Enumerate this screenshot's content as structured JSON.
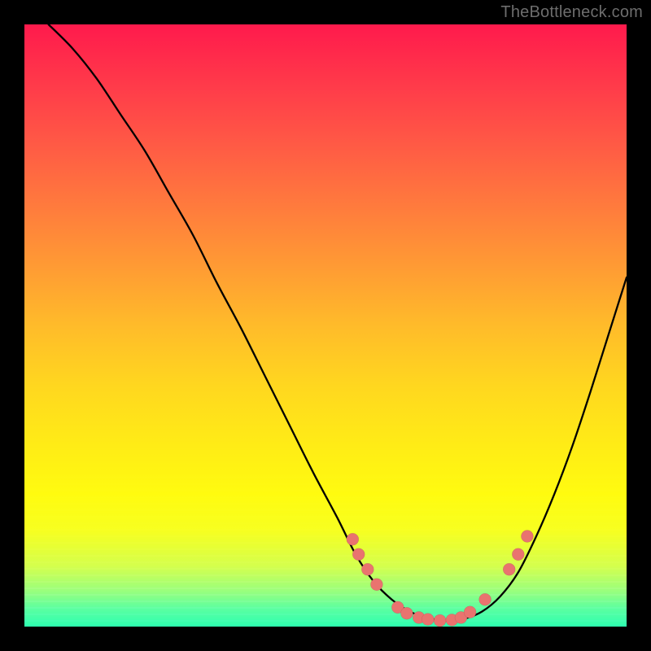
{
  "watermark": "TheBottleneck.com",
  "chart_data": {
    "type": "line",
    "title": "",
    "xlabel": "",
    "ylabel": "",
    "xlim": [
      0,
      100
    ],
    "ylim": [
      0,
      100
    ],
    "grid": false,
    "series": [
      {
        "name": "curve",
        "x": [
          4,
          8,
          12,
          16,
          20,
          24,
          28,
          32,
          36,
          40,
          44,
          48,
          52,
          55,
          58,
          61,
          64,
          67,
          70,
          73,
          76,
          79,
          82,
          85,
          88,
          91,
          94,
          97,
          100
        ],
        "y": [
          100,
          96,
          91,
          85,
          79,
          72,
          65,
          57,
          49.5,
          41.5,
          33.5,
          25.5,
          18,
          12,
          7.5,
          4.5,
          2.5,
          1.4,
          1,
          1.3,
          2.5,
          5,
          9,
          15,
          22,
          30,
          39,
          48.5,
          58
        ]
      }
    ],
    "markers": [
      {
        "x": 54.5,
        "y": 14.5
      },
      {
        "x": 55.5,
        "y": 12
      },
      {
        "x": 57,
        "y": 9.5
      },
      {
        "x": 58.5,
        "y": 7
      },
      {
        "x": 62,
        "y": 3.2
      },
      {
        "x": 63.5,
        "y": 2.2
      },
      {
        "x": 65.5,
        "y": 1.5
      },
      {
        "x": 67,
        "y": 1.2
      },
      {
        "x": 69,
        "y": 1.0
      },
      {
        "x": 71,
        "y": 1.1
      },
      {
        "x": 72.5,
        "y": 1.5
      },
      {
        "x": 74,
        "y": 2.4
      },
      {
        "x": 76.5,
        "y": 4.5
      },
      {
        "x": 80.5,
        "y": 9.5
      },
      {
        "x": 82,
        "y": 12
      },
      {
        "x": 83.5,
        "y": 15
      }
    ],
    "colors": {
      "curve": "#000000",
      "marker": "#e9736f",
      "gradient_top": "#ff1a4c",
      "gradient_bottom": "#2effb0"
    }
  }
}
